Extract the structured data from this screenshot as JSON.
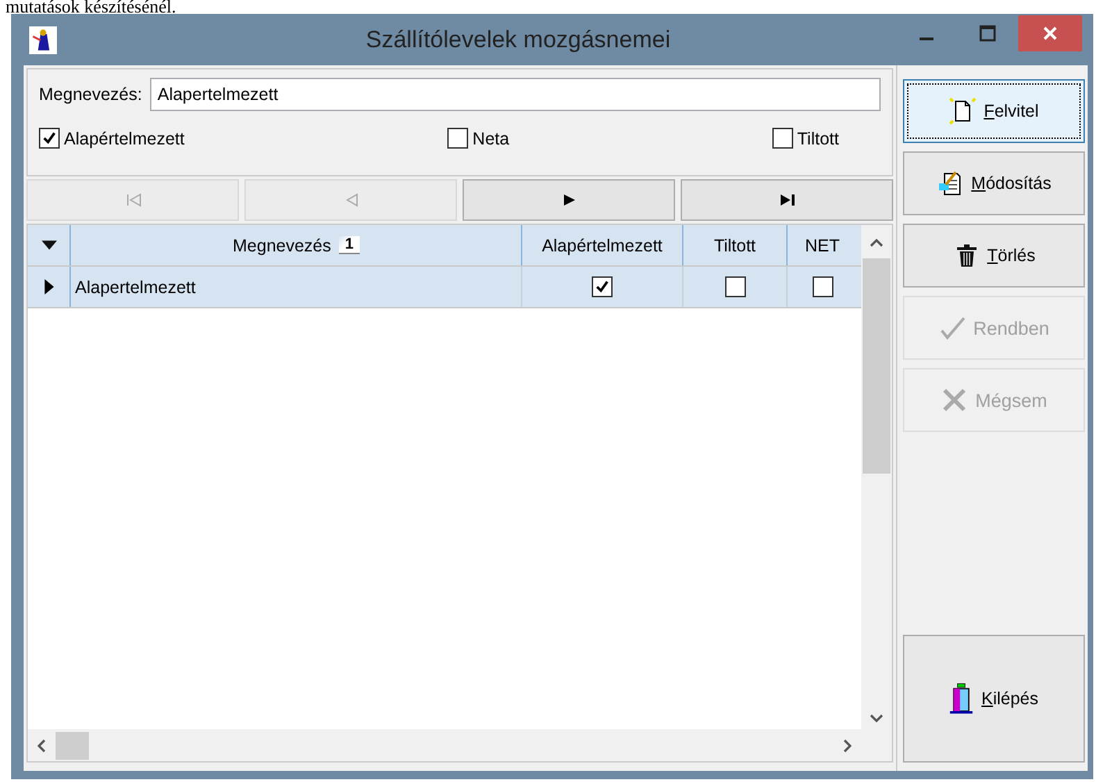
{
  "page_text": "mutatások készítésénél.",
  "window": {
    "title": "Szállítólevelek mozgásnemei"
  },
  "form": {
    "name_label": "Megnevezés:",
    "name_value": "Alapertelmezett",
    "checkboxes": [
      {
        "label": "Alapértelmezett",
        "checked": true
      },
      {
        "label": "Neta",
        "checked": false
      },
      {
        "label": "Tiltott",
        "checked": false
      }
    ]
  },
  "navigator": [
    {
      "kind": "first",
      "disabled": true
    },
    {
      "kind": "prior",
      "disabled": true
    },
    {
      "kind": "next",
      "disabled": false
    },
    {
      "kind": "last",
      "disabled": false
    }
  ],
  "table": {
    "columns": [
      {
        "label": "Megnevezés",
        "sort_badge": "1",
        "kind": "text"
      },
      {
        "label": "Alapértelmezett",
        "kind": "check"
      },
      {
        "label": "Tiltott",
        "kind": "check"
      },
      {
        "label": "NET",
        "kind": "check"
      }
    ],
    "rows": [
      {
        "current": true,
        "cells": [
          {
            "text": "Alapertelmezett"
          },
          {
            "checked": true
          },
          {
            "checked": false
          },
          {
            "checked": false
          }
        ]
      }
    ]
  },
  "buttons": [
    {
      "label": "Felvitel",
      "kind": "new",
      "disabled": false,
      "focused": true,
      "underline_first": true
    },
    {
      "label": "Módosítás",
      "kind": "edit",
      "disabled": false,
      "focused": false,
      "underline_first": true
    },
    {
      "label": "Törlés",
      "kind": "delete",
      "disabled": false,
      "focused": false,
      "underline_first": true
    },
    {
      "label": "Rendben",
      "kind": "ok",
      "disabled": true,
      "focused": false,
      "underline_first": false
    },
    {
      "label": "Mégsem",
      "kind": "cancel",
      "disabled": true,
      "focused": false,
      "underline_first": false
    }
  ],
  "exit_button": {
    "label": "Kilépés",
    "underline_first": true
  }
}
